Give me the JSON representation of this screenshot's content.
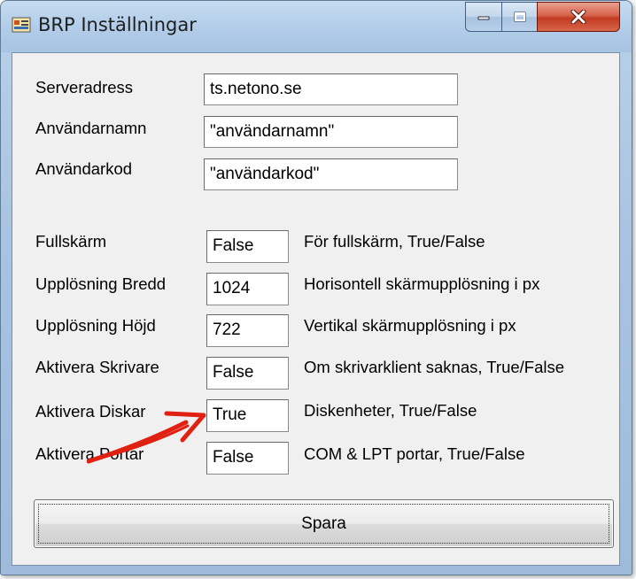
{
  "window": {
    "title": "BRP Inställningar"
  },
  "titlebar_controls": {
    "minimize_icon": "minimize-icon",
    "maximize_icon": "maximize-icon",
    "close_icon": "close-icon"
  },
  "server": {
    "address_label": "Serveradress",
    "address_value": "ts.netono.se",
    "username_label": "Användarnamn",
    "username_value": "\"användarnamn\"",
    "password_label": "Användarkod",
    "password_value": "\"användarkod\""
  },
  "settings": [
    {
      "label": "Fullskärm",
      "value": "False",
      "hint": "För fullskärm, True/False"
    },
    {
      "label": "Upplösning Bredd",
      "value": "1024",
      "hint": "Horisontell skärmupplösning i px"
    },
    {
      "label": "Upplösning Höjd",
      "value": "722",
      "hint": "Vertikal skärmupplösning i px"
    },
    {
      "label": "Aktivera Skrivare",
      "value": "False",
      "hint": "Om skrivarklient saknas, True/False"
    },
    {
      "label": "Aktivera Diskar",
      "value": "True",
      "hint": "Diskenheter, True/False"
    },
    {
      "label": "Aktivera Portar",
      "value": "False",
      "hint": "COM & LPT portar, True/False"
    }
  ],
  "save_button": {
    "label": "Spara"
  },
  "annotation": {
    "arrow_color": "#e02010"
  },
  "colors": {
    "titlebar": "#b3cde9",
    "close_button": "#c23a22",
    "client_bg": "#f0f0f0"
  }
}
